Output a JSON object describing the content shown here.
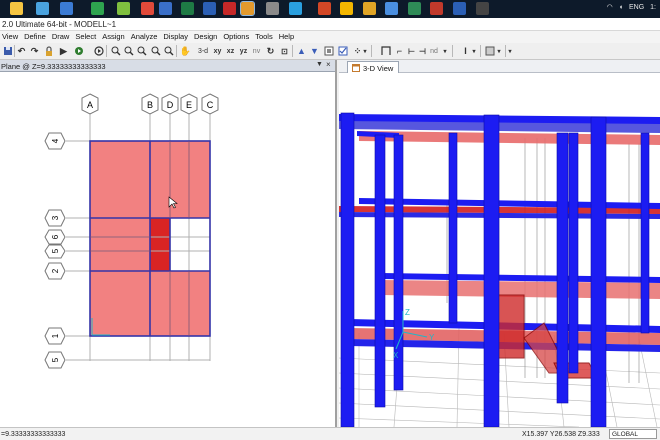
{
  "taskbar": {
    "icons": [
      {
        "name": "file-explorer-icon",
        "color": "#f5c542"
      },
      {
        "name": "monitor-icon",
        "color": "#4aa3df"
      },
      {
        "name": "store-icon",
        "color": "#3b7bd4"
      },
      {
        "name": "edge-icon",
        "color": "#2ea44f"
      },
      {
        "name": "media-player-icon",
        "color": "#7fbf3f"
      },
      {
        "name": "gmail-icon",
        "color": "#e04a3a"
      },
      {
        "name": "matlab-icon",
        "color": "#3a6fc9"
      },
      {
        "name": "excel-icon",
        "color": "#1e7a45"
      },
      {
        "name": "word-icon",
        "color": "#2b5fb5"
      },
      {
        "name": "autocad-icon",
        "color": "#c62828"
      },
      {
        "name": "etabs-icon",
        "color": "#e39a2d"
      },
      {
        "name": "calculator-icon",
        "color": "#8a8a8a"
      },
      {
        "name": "skype-icon",
        "color": "#2aa0e0"
      },
      {
        "name": "powerpoint-icon",
        "color": "#d24726"
      },
      {
        "name": "notes-icon",
        "color": "#f2b600"
      },
      {
        "name": "folder-icon",
        "color": "#e0a526"
      },
      {
        "name": "chrome-icon",
        "color": "#4a8fe0"
      },
      {
        "name": "downloads-icon",
        "color": "#2e8b57"
      },
      {
        "name": "pdf-icon",
        "color": "#c0392b"
      },
      {
        "name": "word2-icon",
        "color": "#2b5fb5"
      },
      {
        "name": "terminal-icon",
        "color": "#444"
      }
    ],
    "lang": "ENG",
    "clock": "1:"
  },
  "title": "2.0 Ultimate 64-bit - MODELL~1",
  "menu": [
    "View",
    "Define",
    "Draw",
    "Select",
    "Assign",
    "Analyze",
    "Display",
    "Design",
    "Options",
    "Tools",
    "Help"
  ],
  "toolbar": {
    "view_3d": "3-d",
    "view_xy": "xy",
    "view_xz": "xz",
    "view_yz": "yz",
    "view_nv": "nv",
    "snap_nd": "nd"
  },
  "plan_view": {
    "title": "Plane @ Z=9.33333333333333",
    "pin": "▼",
    "close": "×",
    "grid_x": [
      "A",
      "B",
      "D",
      "E",
      "C"
    ],
    "grid_y": [
      "4",
      "3",
      "6",
      "5",
      "2",
      "1",
      "5"
    ]
  },
  "view_3d": {
    "tab_label": "3-D View",
    "axis_x": "X",
    "axis_y": "Y",
    "axis_z": "Z"
  },
  "status": {
    "left": "=9.33333333333333",
    "coords": "X15.397  Y26.538  Z9.333",
    "system": "GLOBAL"
  },
  "colors": {
    "column_blue": "#1c1cf2",
    "slab_red": "#f07070",
    "beam_red": "#d01818",
    "plan_line": "#3030a0"
  }
}
